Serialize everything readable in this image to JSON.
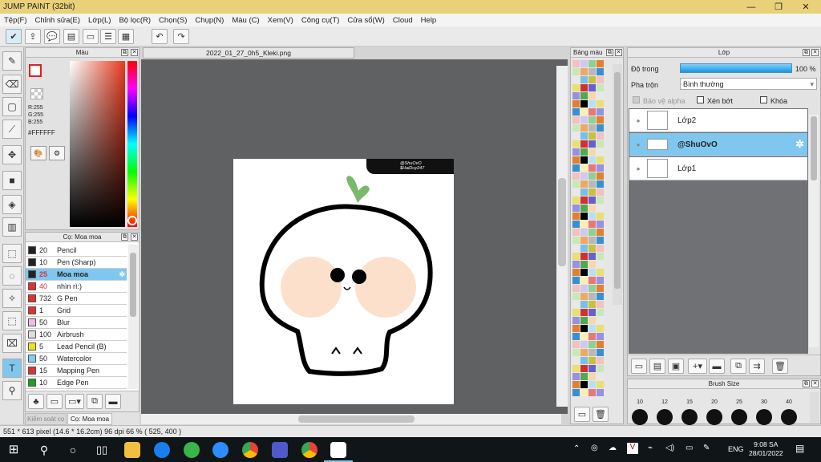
{
  "window": {
    "title": "JUMP PAINT (32bit)"
  },
  "menu": [
    "Tệp(F)",
    "Chỉnh sửa(E)",
    "Lớp(L)",
    "Bộ lọc(R)",
    "Chọn(S)",
    "Chụp(N)",
    "Màu (C)",
    "Xem(V)",
    "Công cụ(T)",
    "Cửa sổ(W)",
    "Cloud",
    "Help"
  ],
  "color_panel": {
    "title": "Màu",
    "r": "R:255",
    "g": "G:255",
    "b": "B:255",
    "hex": "#FFFFFF",
    "primary": "#ffffff",
    "accent": "#e02020"
  },
  "brush_panel": {
    "title": "Cọ: Moa moa",
    "brushes": [
      {
        "size": "20",
        "name": "Pencil",
        "color": "#222222"
      },
      {
        "size": "10",
        "name": "Pen (Sharp)",
        "color": "#222222"
      },
      {
        "size": "25",
        "name": "Moa moa",
        "color": "#222222"
      },
      {
        "size": "40",
        "name": "nhìn rì:)",
        "color": "#e03030"
      },
      {
        "size": "732",
        "name": "G Pen",
        "color": "#e03030"
      },
      {
        "size": "1",
        "name": "Grid",
        "color": "#e03030"
      },
      {
        "size": "50",
        "name": "Blur",
        "color": "#f4b8e8"
      },
      {
        "size": "100",
        "name": "Airbrush",
        "color": "#dddddd"
      },
      {
        "size": "5",
        "name": "Lead Pencil (B)",
        "color": "#f0e020"
      },
      {
        "size": "50",
        "name": "Watercolor",
        "color": "#7ad0f0"
      },
      {
        "size": "15",
        "name": "Mapping Pen",
        "color": "#e03030"
      },
      {
        "size": "10",
        "name": "Edge Pen",
        "color": "#20a020"
      }
    ],
    "tabs": [
      "Kiểm soát cọ",
      "Cọ: Moa moa"
    ]
  },
  "document": {
    "tab": "2022_01_27_0h5_Kleki.png",
    "watermark_line1": "@ShuOvO",
    "watermark_line2": "$HaiDuy247"
  },
  "palette_panel": {
    "title": "Bảng màu"
  },
  "layer_panel": {
    "title": "Lớp",
    "opacity_label": "Độ trong",
    "opacity_value": "100 %",
    "blend_label": "Pha trộn",
    "blend_value": "Bình thường",
    "protect_alpha": "Bảo vệ alpha",
    "clip": "Xén bớt",
    "lock": "Khóa",
    "layers": [
      {
        "name": "Lớp2",
        "selected": false
      },
      {
        "name": "@ShuOvO",
        "selected": true
      },
      {
        "name": "Lớp1",
        "selected": false
      }
    ]
  },
  "brush_size": {
    "title": "Brush Size",
    "sizes": [
      "10",
      "12",
      "15",
      "20",
      "25",
      "30",
      "40"
    ]
  },
  "status": {
    "text": "551 * 613 pixel   (14.6 * 16.2cm)   96 dpi   66 %   ( 525, 400 )"
  },
  "taskbar": {
    "lang": "ENG",
    "time": "9:08 SA",
    "date": "28/01/2022"
  }
}
